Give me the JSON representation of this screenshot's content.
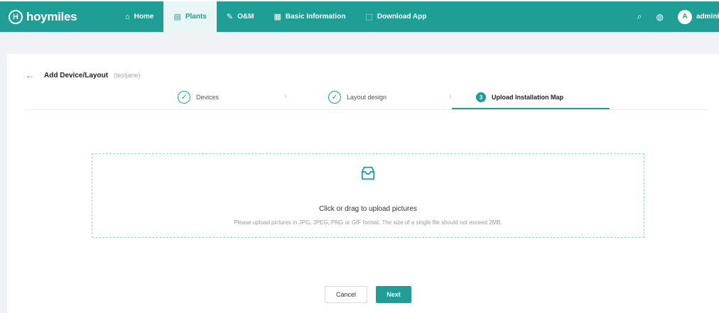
{
  "brand": {
    "logo_mark": "H",
    "name": "hoymiles"
  },
  "nav": {
    "items": [
      {
        "label": "Home",
        "icon": "⌂",
        "icon_name": "home-icon",
        "active": false
      },
      {
        "label": "Plants",
        "icon": "▤",
        "icon_name": "plants-icon",
        "active": true
      },
      {
        "label": "O&M",
        "icon": "✎",
        "icon_name": "wrench-icon",
        "active": false
      },
      {
        "label": "Basic Information",
        "icon": "▦",
        "icon_name": "document-icon",
        "active": false
      },
      {
        "label": "Download App",
        "icon": "⬚",
        "icon_name": "download-icon",
        "active": false
      }
    ],
    "search_icon": "⌕",
    "globe_icon": "◍",
    "avatar_initial": "A",
    "username": "adminH"
  },
  "page": {
    "back_icon": "←",
    "title": "Add Device/Layout",
    "plant_name": "(testjane)"
  },
  "steps": [
    {
      "label": "Devices",
      "status": "done",
      "marker": "✓"
    },
    {
      "label": "Layout design",
      "status": "done",
      "marker": "✓"
    },
    {
      "label": "Upload Installation Map",
      "status": "active",
      "marker": "3"
    }
  ],
  "step_separator": "›",
  "upload": {
    "title": "Click or drag to upload pictures",
    "hint": "Please upload pictures in JPG, JPEG, PNG or GIF format. The size of a single file should not exceed 2MB."
  },
  "buttons": {
    "cancel": "Cancel",
    "next": "Next"
  },
  "colors": {
    "brand": "#1e9e94",
    "background": "#f0f2f5"
  }
}
